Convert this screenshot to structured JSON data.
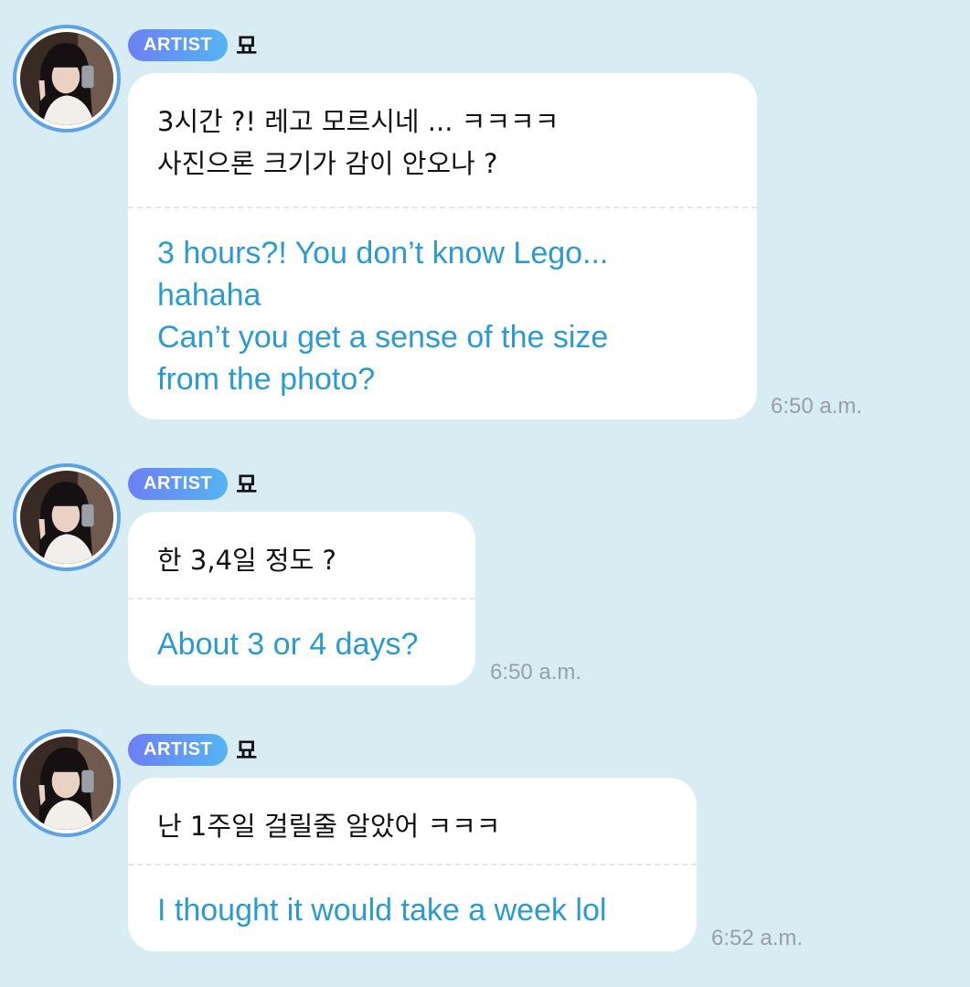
{
  "colors": {
    "background": "#d8ecf4",
    "bubble": "#ffffff",
    "korean_text": "#111111",
    "english_text": "#2b9ad3",
    "timestamp": "#9a9fa3",
    "badge_gradient_start": "#6d7ff4",
    "badge_gradient_end": "#55b4f2",
    "avatar_ring": "#5aa2ea"
  },
  "messages": [
    {
      "badge": "ARTIST",
      "sender": "묘",
      "avatar_icon": "profile-photo",
      "text_original": "3시간 ?! 레고 모르시네 ... ㅋㅋㅋㅋ\n사진으론 크기가 감이 안오나 ?",
      "text_translation": "3 hours?! You don’t know Lego...\nhahaha\nCan’t you get a sense of the size\nfrom the photo?",
      "time": "6:50 a.m."
    },
    {
      "badge": "ARTIST",
      "sender": "묘",
      "avatar_icon": "profile-photo",
      "text_original": "한 3,4일 정도 ?",
      "text_translation": "About 3 or 4 days?",
      "time": "6:50 a.m."
    },
    {
      "badge": "ARTIST",
      "sender": "묘",
      "avatar_icon": "profile-photo",
      "text_original": "난 1주일 걸릴줄 알았어 ㅋㅋㅋ",
      "text_translation": "I thought it would take a week lol",
      "time": "6:52 a.m."
    }
  ]
}
